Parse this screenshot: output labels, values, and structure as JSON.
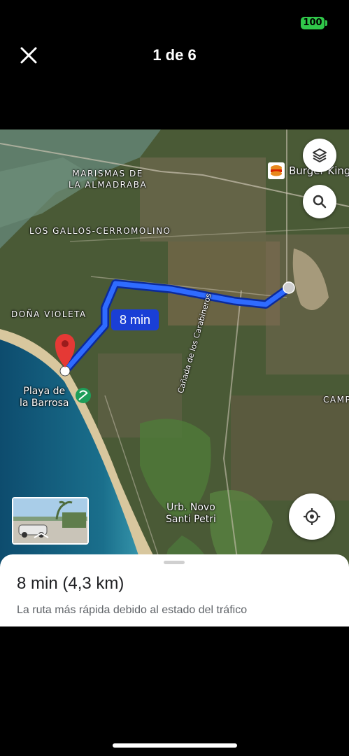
{
  "status_bar": {
    "battery_level": "100",
    "battery_color": "#30c84a"
  },
  "viewer": {
    "title": "1 de 6",
    "close_icon": "close-icon"
  },
  "map": {
    "area_labels": {
      "marismas": "MARISMAS DE\nLA ALMADRABA",
      "los_gallos": "LOS GALLOS-CERROMOLINO",
      "dona_violeta": "DOÑA VIOLETA",
      "camp": "CAMP"
    },
    "place_labels": {
      "playa": "Playa de\nla Barrosa",
      "urb": "Urb. Novo\nSanti Petri",
      "canada": "Cañada de los Carabineros"
    },
    "poi": {
      "burger_king": "Burger King"
    },
    "route_badge": "8 min",
    "route_color": "#1a3fd6",
    "destination_marker_color": "#e53935",
    "buttons": {
      "layers_icon": "layers-icon",
      "search_icon": "search-icon",
      "locate_icon": "my-location-icon"
    }
  },
  "sheet": {
    "title": "8 min (4,3 km)",
    "subtitle": "La ruta más rápida debido al estado del tráfico"
  }
}
